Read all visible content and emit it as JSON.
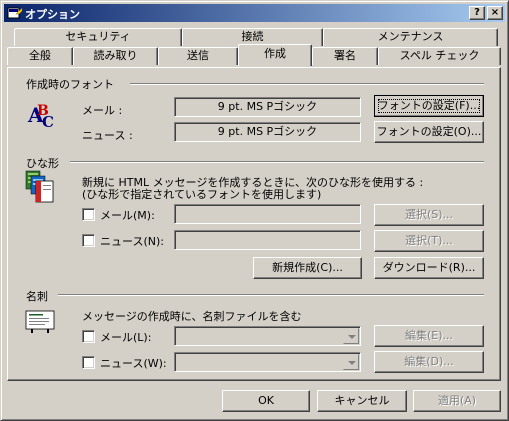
{
  "window": {
    "title": "オプション",
    "help_btn": "?",
    "close_btn": "×"
  },
  "tabs": {
    "row1": [
      "セキュリティ",
      "接続",
      "メンテナンス"
    ],
    "row2": [
      "全般",
      "読み取り",
      "送信",
      "作成",
      "署名",
      "スペル チェック"
    ],
    "active": "作成"
  },
  "fonts_group": {
    "title": "作成時のフォント",
    "mail_label": "メール :",
    "mail_font": "9 pt. MS Pゴシック",
    "mail_button": "フォントの設定(F)...",
    "news_label": "ニュース :",
    "news_font": "9 pt. MS Pゴシック",
    "news_button": "フォントの設定(O)..."
  },
  "stationery_group": {
    "title": "ひな形",
    "description_line1": "新規に HTML メッセージを作成するときに、次のひな形を使用する :",
    "description_line2": "(ひな形で指定されているフォントを使用します)",
    "mail_checkbox": "メール(M):",
    "mail_value": "",
    "mail_select_button": "選択(S)...",
    "news_checkbox": "ニュース(N):",
    "news_value": "",
    "news_select_button": "選択(T)...",
    "create_new_button": "新規作成(C)...",
    "download_button": "ダウンロード(R)..."
  },
  "business_card_group": {
    "title": "名刺",
    "description": "メッセージの作成時に、名刺ファイルを含む",
    "mail_checkbox": "メール(L):",
    "mail_value": "",
    "mail_edit_button": "編集(E)...",
    "news_checkbox": "ニュース(W):",
    "news_value": "",
    "news_edit_button": "編集(D)..."
  },
  "footer": {
    "ok": "OK",
    "cancel": "キャンセル",
    "apply": "適用(A)"
  }
}
